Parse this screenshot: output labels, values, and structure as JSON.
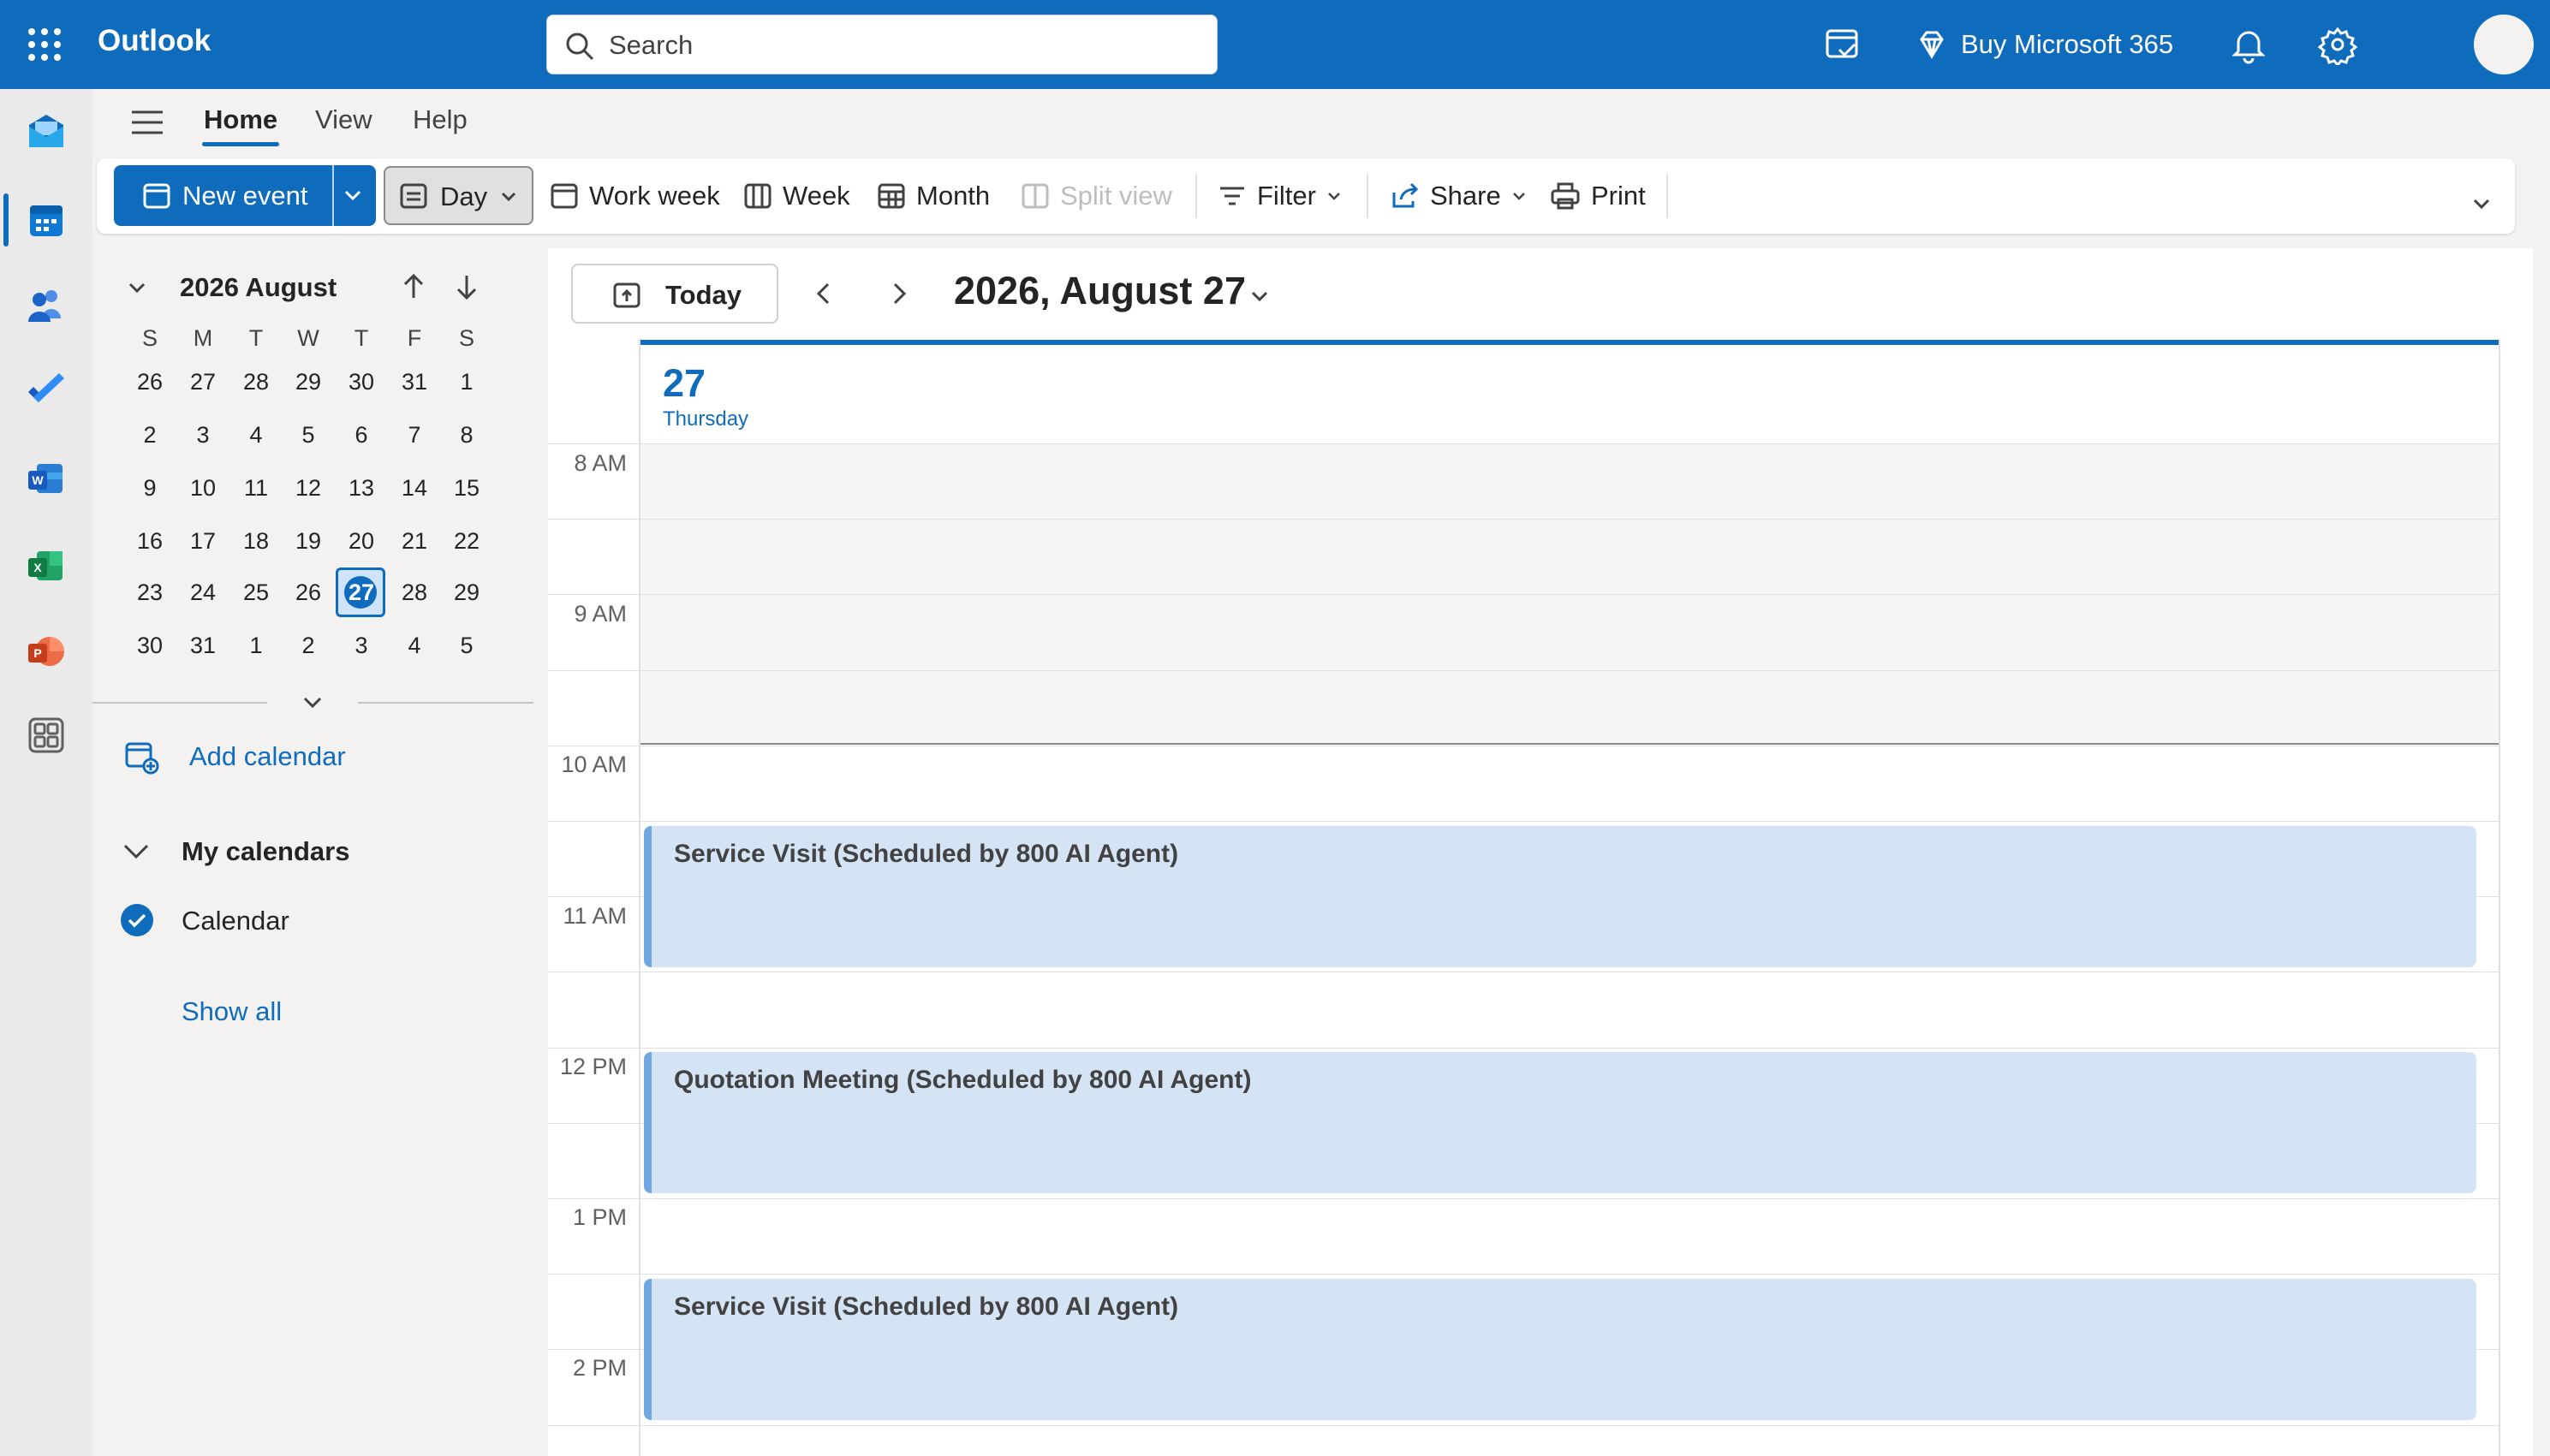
{
  "app": {
    "title": "Outlook"
  },
  "search": {
    "placeholder": "Search"
  },
  "topbar": {
    "buy_label": "Buy Microsoft 365",
    "accent": "#0f6cbd"
  },
  "rail": {
    "apps": [
      "mail-icon",
      "calendar-icon",
      "people-icon",
      "todo-icon",
      "word-icon",
      "excel-icon",
      "powerpoint-icon",
      "more-apps-icon"
    ],
    "active": "calendar-icon"
  },
  "ribbon": {
    "tabs": [
      {
        "label": "Home",
        "selected": true
      },
      {
        "label": "View",
        "selected": false
      },
      {
        "label": "Help",
        "selected": false
      }
    ]
  },
  "toolbar": {
    "new_event": "New event",
    "day": "Day",
    "work_week": "Work week",
    "week": "Week",
    "month": "Month",
    "split_view": "Split view",
    "filter": "Filter",
    "share": "Share",
    "print": "Print"
  },
  "minical": {
    "header": "2026 August",
    "dow": [
      "S",
      "M",
      "T",
      "W",
      "T",
      "F",
      "S"
    ],
    "weeks": [
      [
        "26",
        "27",
        "28",
        "29",
        "30",
        "31",
        "1"
      ],
      [
        "2",
        "3",
        "4",
        "5",
        "6",
        "7",
        "8"
      ],
      [
        "9",
        "10",
        "11",
        "12",
        "13",
        "14",
        "15"
      ],
      [
        "16",
        "17",
        "18",
        "19",
        "20",
        "21",
        "22"
      ],
      [
        "23",
        "24",
        "25",
        "26",
        "27",
        "28",
        "29"
      ],
      [
        "30",
        "31",
        "1",
        "2",
        "3",
        "4",
        "5"
      ]
    ],
    "selected": "27"
  },
  "sidebar": {
    "add_calendar": "Add calendar",
    "my_calendars": "My calendars",
    "calendar": "Calendar",
    "show_all": "Show all"
  },
  "main": {
    "today": "Today",
    "date_title": "2026, August 27",
    "day_number": "27",
    "day_name": "Thursday",
    "times": [
      "8 AM",
      "9 AM",
      "10 AM",
      "11 AM",
      "12 PM",
      "1 PM",
      "2 PM"
    ],
    "events": [
      {
        "title": "Service Visit (Scheduled by 800 AI Agent)"
      },
      {
        "title": "Quotation Meeting (Scheduled by 800 AI Agent)"
      },
      {
        "title": "Service Visit (Scheduled by 800 AI Agent)"
      }
    ]
  }
}
